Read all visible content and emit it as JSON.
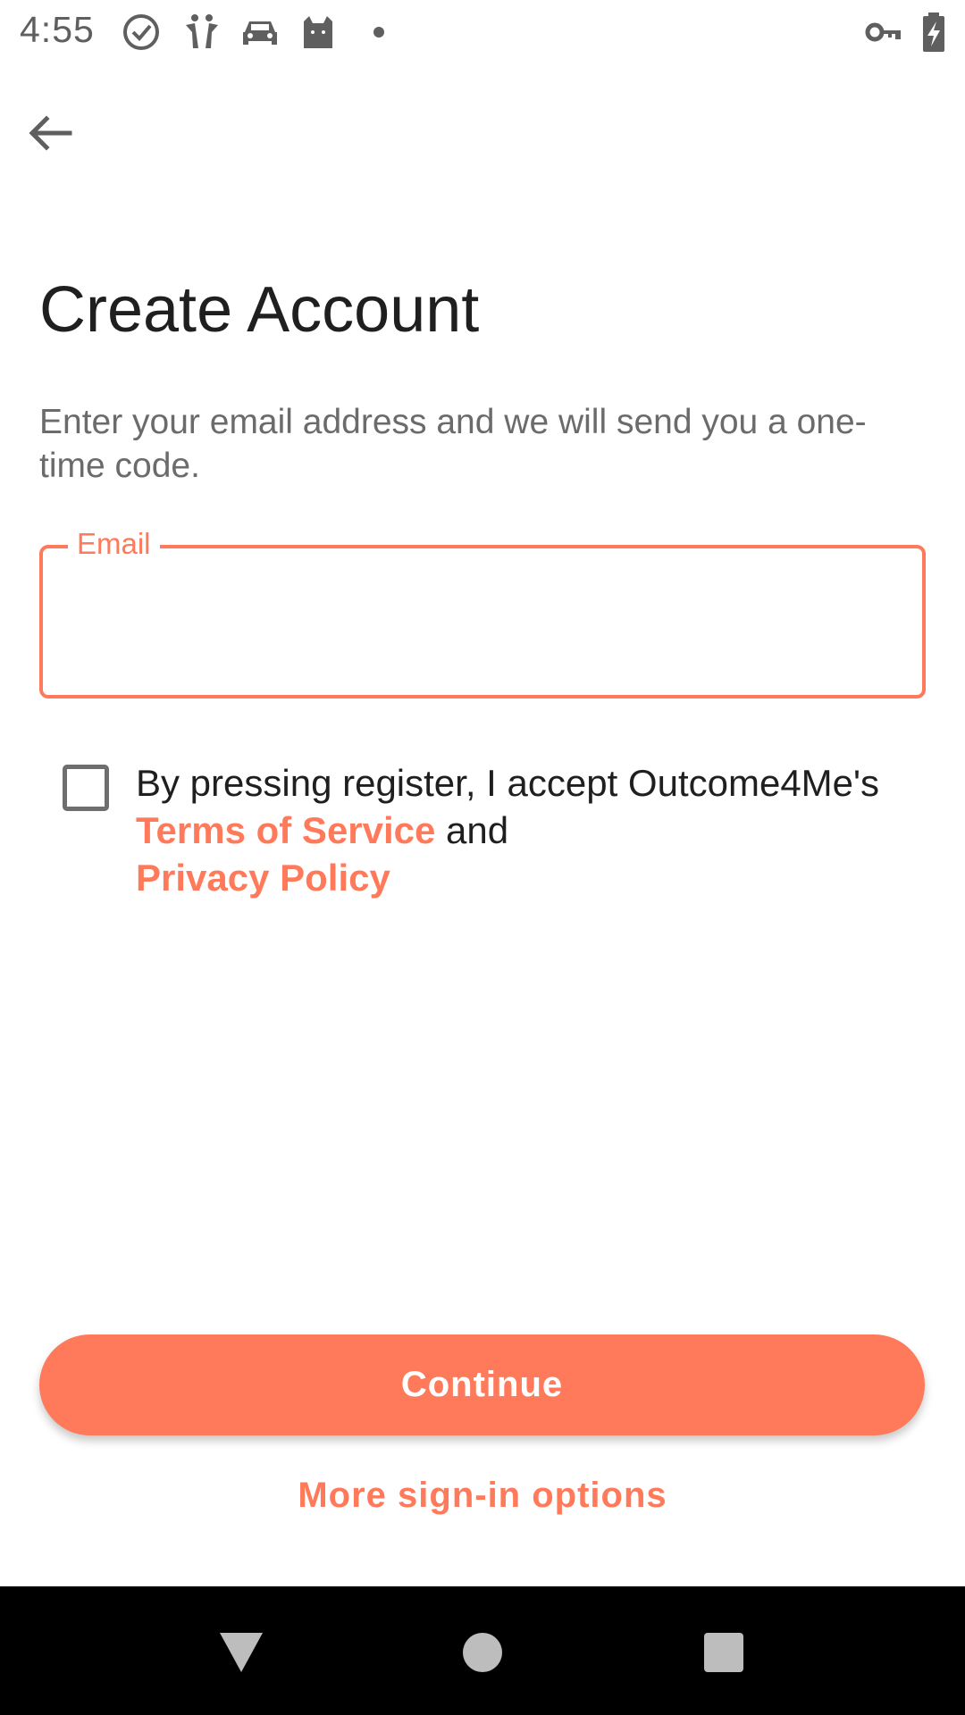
{
  "status_bar": {
    "time": "4:55",
    "icons": [
      "check-circle-icon",
      "app-figures-icon",
      "car-icon",
      "cat-icon",
      "dot-icon",
      "vpn-key-icon",
      "battery-charging-icon"
    ]
  },
  "header": {
    "back_icon": "arrow-left-icon"
  },
  "main": {
    "title": "Create Account",
    "subtitle": "Enter your email address and we will send you a one-time code.",
    "email": {
      "label": "Email",
      "value": "",
      "placeholder": ""
    },
    "terms": {
      "checked": false,
      "text_before": "By pressing register, I accept Outcome4Me's ",
      "terms_link": "Terms of Service",
      "text_middle": " and ",
      "privacy_link": "Privacy Policy"
    },
    "continue_label": "Continue",
    "more_options_label": "More sign-in options"
  },
  "colors": {
    "accent": "#ff7a5a",
    "title": "#1f1f1f",
    "subtitle": "#6b6b6b",
    "nav_bar": "#000000"
  },
  "nav_bar": {
    "icons": [
      "back-triangle-icon",
      "home-circle-icon",
      "recents-square-icon"
    ]
  }
}
